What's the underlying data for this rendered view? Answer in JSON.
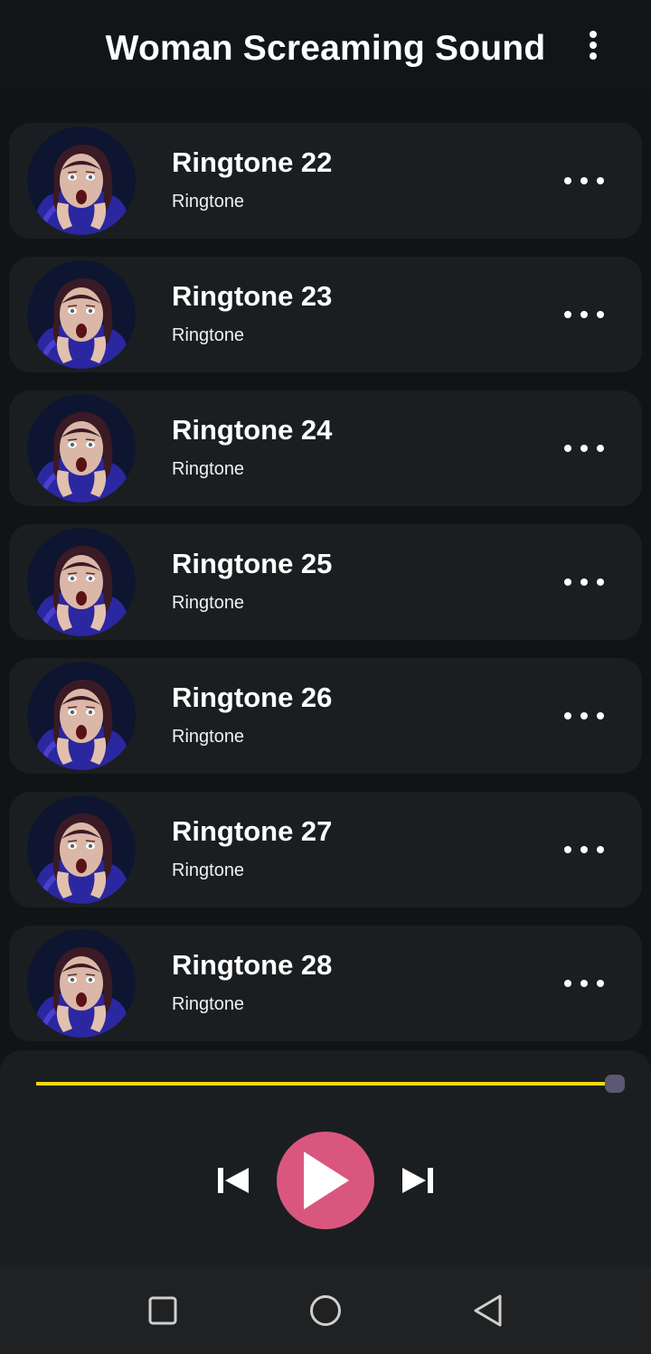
{
  "app_bar": {
    "title": "Woman Screaming Sound",
    "menu_icon": "more-vert-icon"
  },
  "ringtones": [
    {
      "title": "Ringtone 22",
      "subtitle": "Ringtone"
    },
    {
      "title": "Ringtone 23",
      "subtitle": "Ringtone"
    },
    {
      "title": "Ringtone 24",
      "subtitle": "Ringtone"
    },
    {
      "title": "Ringtone 25",
      "subtitle": "Ringtone"
    },
    {
      "title": "Ringtone 26",
      "subtitle": "Ringtone"
    },
    {
      "title": "Ringtone 27",
      "subtitle": "Ringtone"
    },
    {
      "title": "Ringtone 28",
      "subtitle": "Ringtone"
    }
  ],
  "player": {
    "progress": 1.0,
    "progress_color": "#f5d90a",
    "play_button_color": "#d9577f",
    "icons": [
      "skip-previous-icon",
      "play-icon",
      "skip-next-icon"
    ]
  },
  "system_nav": {
    "icons": [
      "recent-apps-icon",
      "home-icon",
      "back-icon"
    ]
  },
  "colors": {
    "background": "#111416",
    "card": "#1b1e20",
    "accent": "#d9577f",
    "seek": "#f5d90a"
  }
}
